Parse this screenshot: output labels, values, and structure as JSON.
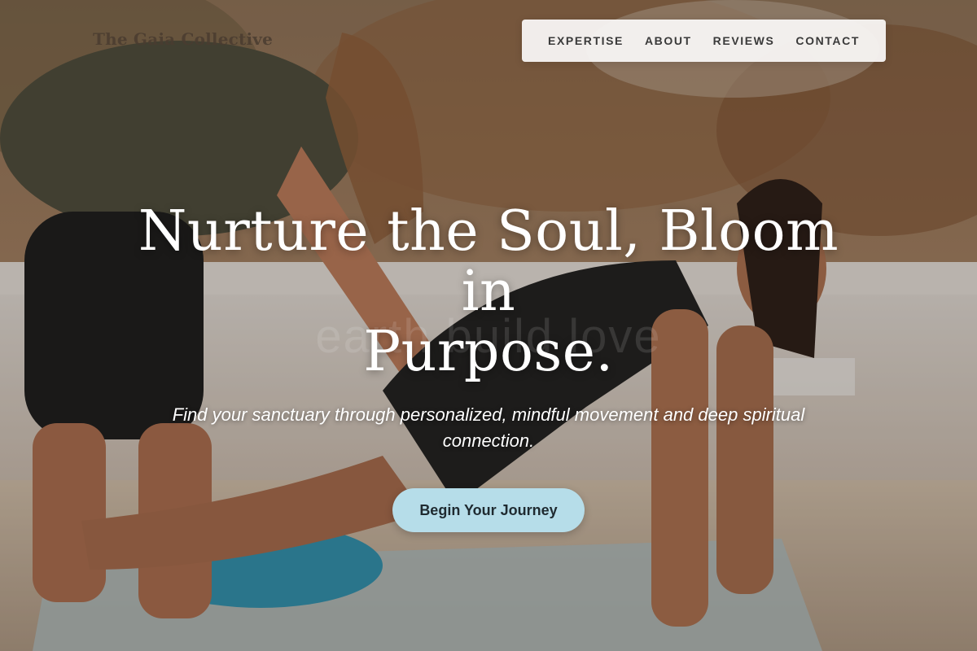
{
  "brand": {
    "name": "The Gaia Collective"
  },
  "nav": {
    "items": [
      {
        "label": "EXPERTISE"
      },
      {
        "label": "ABOUT"
      },
      {
        "label": "REVIEWS"
      },
      {
        "label": "CONTACT"
      }
    ]
  },
  "hero": {
    "title_line1": "Nurture the Soul, Bloom in",
    "title_line2": "Purpose.",
    "watermark": "earth build love",
    "subtitle": "Find your sanctuary through personalized, mindful movement and deep spiritual connection.",
    "cta_label": "Begin Your Journey"
  },
  "colors": {
    "cta_background": "#b6dde9",
    "nav_background": "#f8f6f4",
    "title_text": "#ffffff"
  }
}
